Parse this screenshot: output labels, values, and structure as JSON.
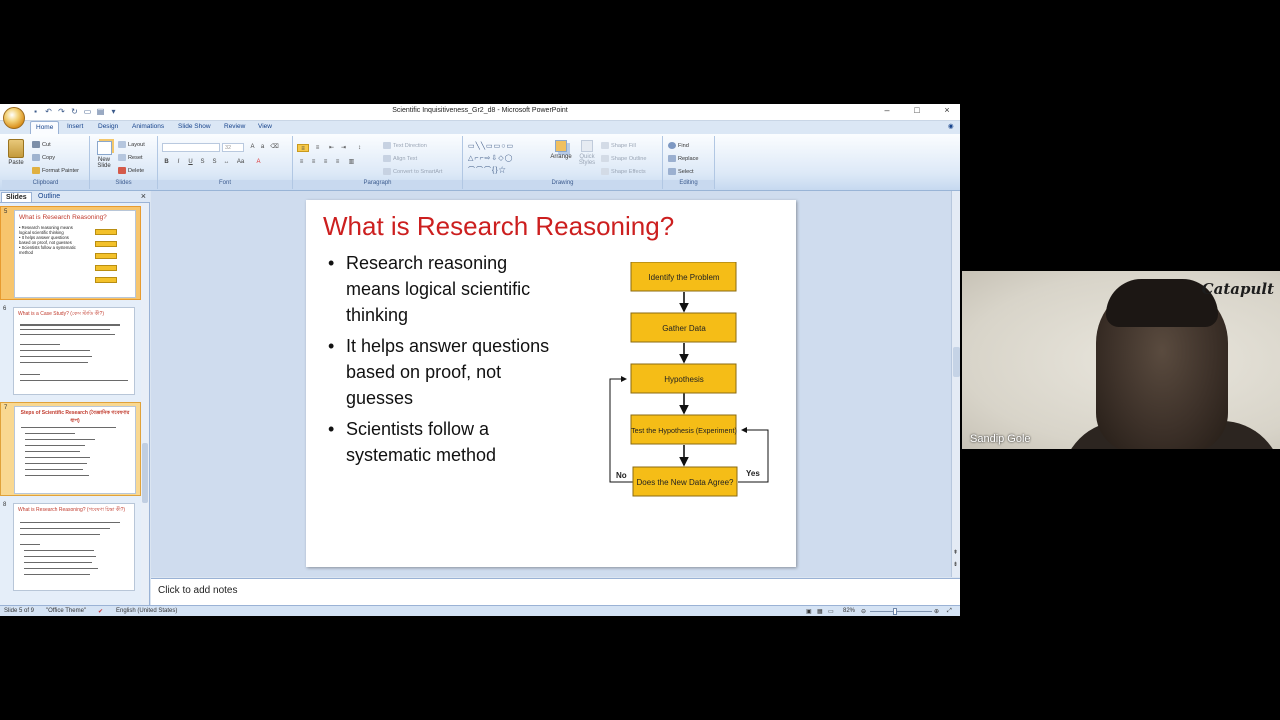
{
  "window": {
    "title": "Scientific Inquisitiveness_Gr2_d8 - Microsoft PowerPoint",
    "controls": [
      "–",
      "□",
      "×"
    ]
  },
  "tabs": [
    "Home",
    "Insert",
    "Design",
    "Animations",
    "Slide Show",
    "Review",
    "View"
  ],
  "ribbon": {
    "clipboard": {
      "paste": "Paste",
      "cut": "Cut",
      "copy": "Copy",
      "format_painter": "Format Painter",
      "label": "Clipboard"
    },
    "slides": {
      "new_slide": "New Slide",
      "layout": "Layout",
      "reset": "Reset",
      "delete": "Delete",
      "label": "Slides"
    },
    "font": {
      "size": "32",
      "label": "Font"
    },
    "paragraph": {
      "text_direction": "Text Direction",
      "align_text": "Align Text",
      "convert_smartart": "Convert to SmartArt",
      "label": "Paragraph"
    },
    "drawing": {
      "arrange": "Arrange",
      "quick_styles": "Quick Styles",
      "shape_fill": "Shape Fill",
      "shape_outline": "Shape Outline",
      "shape_effects": "Shape Effects",
      "label": "Drawing"
    },
    "editing": {
      "find": "Find",
      "replace": "Replace",
      "select": "Select",
      "label": "Editing"
    }
  },
  "pane": {
    "tab_slides": "Slides",
    "tab_outline": "Outline"
  },
  "thumbnails": [
    {
      "num": "5",
      "title": "What is Research Reasoning?"
    },
    {
      "num": "6",
      "title": "What is a Case Study? (কেস স্টাডি কী?)"
    },
    {
      "num": "7",
      "title": "Steps of Scientific Research (বৈজ্ঞানিক গবেষণার ধাপ)"
    },
    {
      "num": "8",
      "title": "What is Research Reasoning? (গবেষণা চিন্তা কী?)"
    }
  ],
  "slide": {
    "title": "What is Research Reasoning?",
    "bullets": [
      "Research reasoning means logical scientific thinking",
      "It helps answer questions based on proof, not guesses",
      "Scientists follow a systematic method"
    ],
    "flowchart": {
      "steps": [
        "Identify the Problem",
        "Gather Data",
        "Hypothesis",
        "Test the Hypothesis (Experiment)",
        "Does the New Data Agree?"
      ],
      "no_label": "No",
      "yes_label": "Yes"
    }
  },
  "notes": {
    "placeholder": "Click to add notes"
  },
  "status": {
    "slide_of": "Slide 5 of 9",
    "theme": "\"Office Theme\"",
    "language": "English (United States)",
    "zoom": "82%"
  },
  "webcam": {
    "logo": "Catapult",
    "participant": "Sandip Gole"
  }
}
